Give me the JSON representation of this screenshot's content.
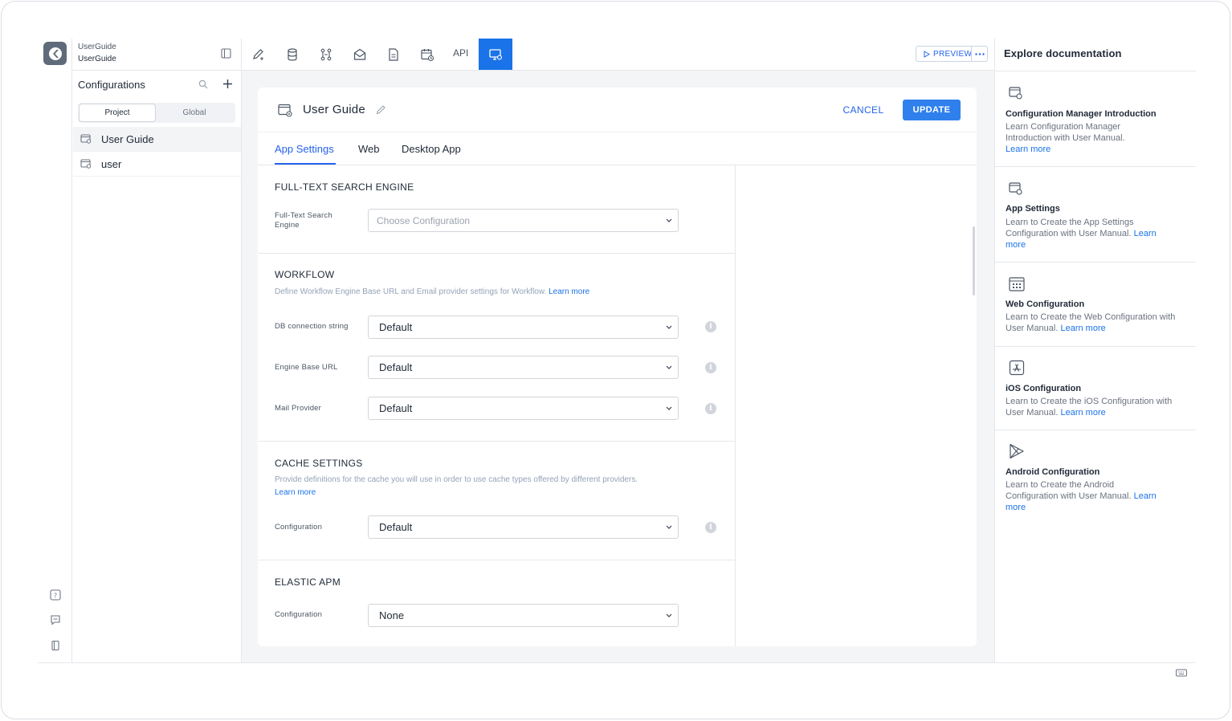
{
  "project": {
    "name_top": "UserGuide",
    "name_bottom": "UserGuide"
  },
  "sidebar": {
    "title": "Configurations",
    "segments": [
      "Project",
      "Global"
    ],
    "items": [
      {
        "label": "User Guide"
      },
      {
        "label": "user"
      }
    ]
  },
  "toolbar": {
    "api_label": "API",
    "preview_label": "PREVIEW"
  },
  "editor": {
    "title": "User Guide",
    "cancel_label": "CANCEL",
    "update_label": "UPDATE",
    "tabs": [
      "App Settings",
      "Web",
      "Desktop App"
    ],
    "sections": {
      "fulltext": {
        "title": "FULL-TEXT SEARCH ENGINE",
        "field_label": "Full-Text Search Engine",
        "placeholder": "Choose Configuration"
      },
      "workflow": {
        "title": "WORKFLOW",
        "desc": "Define Workflow Engine Base URL and Email provider settings for Workflow.",
        "link": "Learn more",
        "fields": [
          {
            "label": "DB connection string",
            "value": "Default"
          },
          {
            "label": "Engine Base URL",
            "value": "Default"
          },
          {
            "label": "Mail Provider",
            "value": "Default"
          }
        ]
      },
      "cache": {
        "title": "CACHE SETTINGS",
        "desc": "Provide definitions for the cache you will use in order to use cache types offered by different providers.",
        "link": "Learn more",
        "field_label": "Configuration",
        "value": "Default"
      },
      "apm": {
        "title": "ELASTIC APM",
        "field_label": "Configuration",
        "value": "None"
      }
    }
  },
  "docs": {
    "heading": "Explore documentation",
    "learn_more": "Learn more",
    "cards": [
      {
        "title": "Configuration Manager Introduction",
        "desc": "Learn Configuration Manager Introduction with User Manual.",
        "icon": "config-window-icon"
      },
      {
        "title": "App Settings",
        "desc": "Learn to Create the App Settings Configuration with User Manual.",
        "icon": "config-window-icon"
      },
      {
        "title": "Web Configuration",
        "desc": "Learn to Create the Web Configuration with User Manual.",
        "icon": "web-grid-icon"
      },
      {
        "title": "iOS Configuration",
        "desc": "Learn to Create the iOS Configuration with User Manual.",
        "icon": "app-store-icon"
      },
      {
        "title": "Android Configuration",
        "desc": "Learn to Create the Android Configuration with User Manual.",
        "icon": "play-store-icon"
      }
    ]
  },
  "colors": {
    "accent": "#1a73e8",
    "button": "#2f80ed",
    "muted": "#94a3b8"
  }
}
